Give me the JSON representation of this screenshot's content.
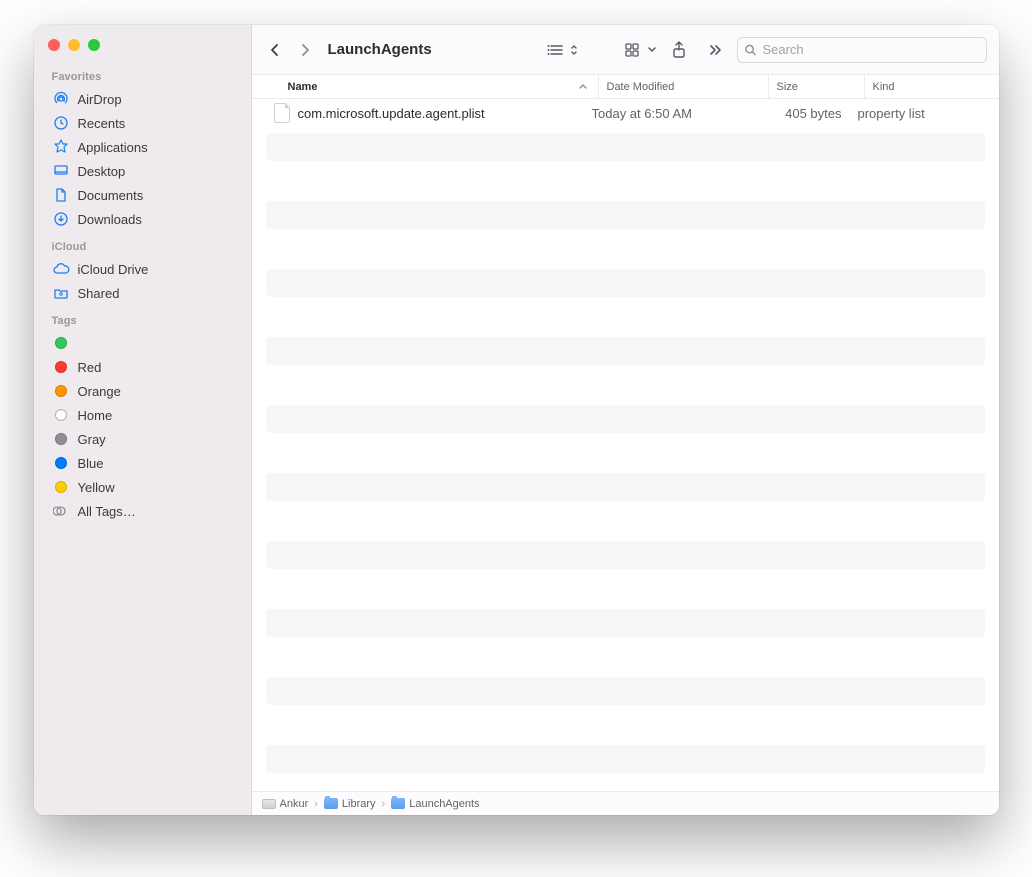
{
  "title": "LaunchAgents",
  "search": {
    "placeholder": "Search"
  },
  "sidebar": {
    "sections": [
      {
        "label": "Favorites",
        "items": [
          {
            "icon": "airdrop",
            "label": "AirDrop"
          },
          {
            "icon": "recents",
            "label": "Recents"
          },
          {
            "icon": "applications",
            "label": "Applications"
          },
          {
            "icon": "desktop",
            "label": "Desktop"
          },
          {
            "icon": "documents",
            "label": "Documents"
          },
          {
            "icon": "downloads",
            "label": "Downloads"
          }
        ]
      },
      {
        "label": "iCloud",
        "items": [
          {
            "icon": "icloud",
            "label": "iCloud Drive"
          },
          {
            "icon": "shared",
            "label": "Shared"
          }
        ]
      },
      {
        "label": "Tags",
        "items": [
          {
            "icon": "dot-green",
            "label": ""
          },
          {
            "icon": "dot-red",
            "label": "Red"
          },
          {
            "icon": "dot-orange",
            "label": "Orange"
          },
          {
            "icon": "dot-empty",
            "label": "Home"
          },
          {
            "icon": "dot-gray",
            "label": "Gray"
          },
          {
            "icon": "dot-blue",
            "label": "Blue"
          },
          {
            "icon": "dot-yellow",
            "label": "Yellow"
          },
          {
            "icon": "alltags",
            "label": "All Tags…"
          }
        ]
      }
    ]
  },
  "columns": {
    "name": "Name",
    "date": "Date Modified",
    "size": "Size",
    "kind": "Kind"
  },
  "files": [
    {
      "name": "com.microsoft.update.agent.plist",
      "date": "Today at 6:50 AM",
      "size": "405 bytes",
      "kind": "property list"
    }
  ],
  "path": [
    {
      "icon": "disk",
      "label": "Ankur"
    },
    {
      "icon": "folder",
      "label": "Library"
    },
    {
      "icon": "folder",
      "label": "LaunchAgents"
    }
  ]
}
